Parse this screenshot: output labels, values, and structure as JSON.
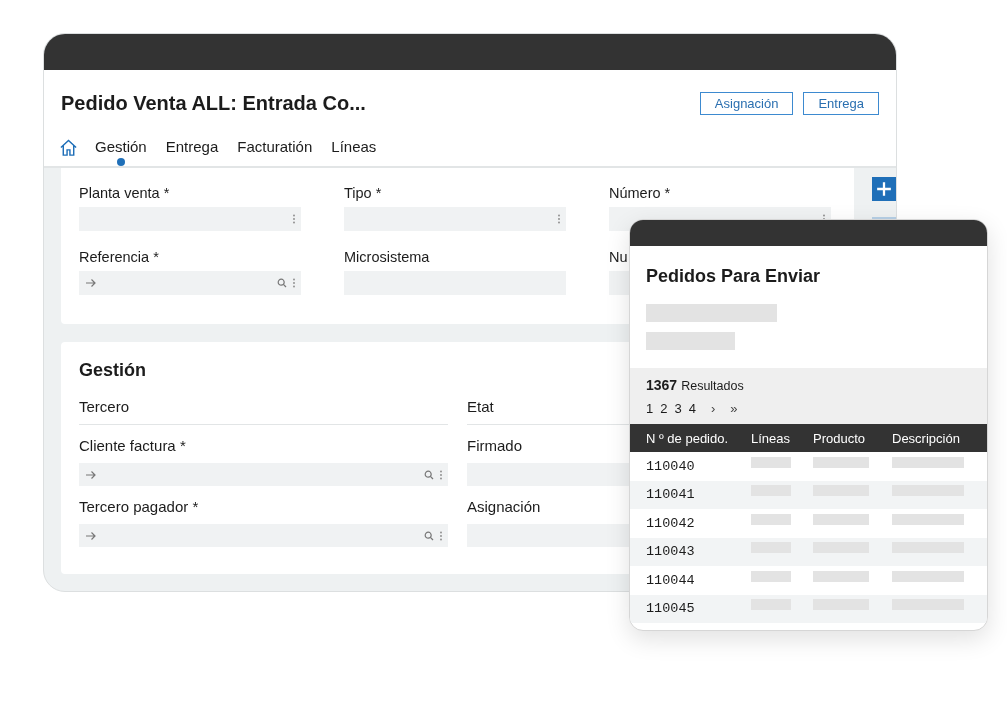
{
  "main_window": {
    "title": "Pedido Venta ALL: Entrada Co...",
    "actions": [
      "Asignación",
      "Entrega"
    ],
    "tabs": [
      {
        "label": "Gestión",
        "selected": true
      },
      {
        "label": "Entrega",
        "selected": false
      },
      {
        "label": "Facturatión",
        "selected": false
      },
      {
        "label": "Líneas",
        "selected": false
      }
    ],
    "header_fields": [
      {
        "label": "Planta venta *",
        "kind": "select"
      },
      {
        "label": "Tipo *",
        "kind": "select"
      },
      {
        "label": "Número *",
        "kind": "select"
      },
      {
        "label": "Referencia *",
        "kind": "lookup"
      },
      {
        "label": "Microsistema",
        "kind": "plain"
      },
      {
        "label": "Nu",
        "kind": "plain"
      }
    ],
    "section": {
      "title": "Gestión",
      "fields": [
        {
          "label": "Tercero",
          "kind": "display"
        },
        {
          "label": "Etat",
          "kind": "display"
        },
        {
          "label": "Cliente factura *",
          "kind": "lookup"
        },
        {
          "label": "Firmado",
          "kind": "plain"
        },
        {
          "label": "Tercero pagador *",
          "kind": "lookup"
        },
        {
          "label": "Asignación",
          "kind": "plain"
        }
      ]
    }
  },
  "popup": {
    "title": "Pedidos Para Enviar",
    "count": "1367",
    "count_label": "Resultados",
    "pages": [
      "1",
      "2",
      "3",
      "4"
    ],
    "next": "›",
    "last": "»",
    "columns": [
      "N º de pedido.",
      "Líneas",
      "Producto",
      "Descripción"
    ],
    "rows": [
      "110040",
      "110041",
      "110042",
      "110043",
      "110044",
      "110045"
    ]
  }
}
